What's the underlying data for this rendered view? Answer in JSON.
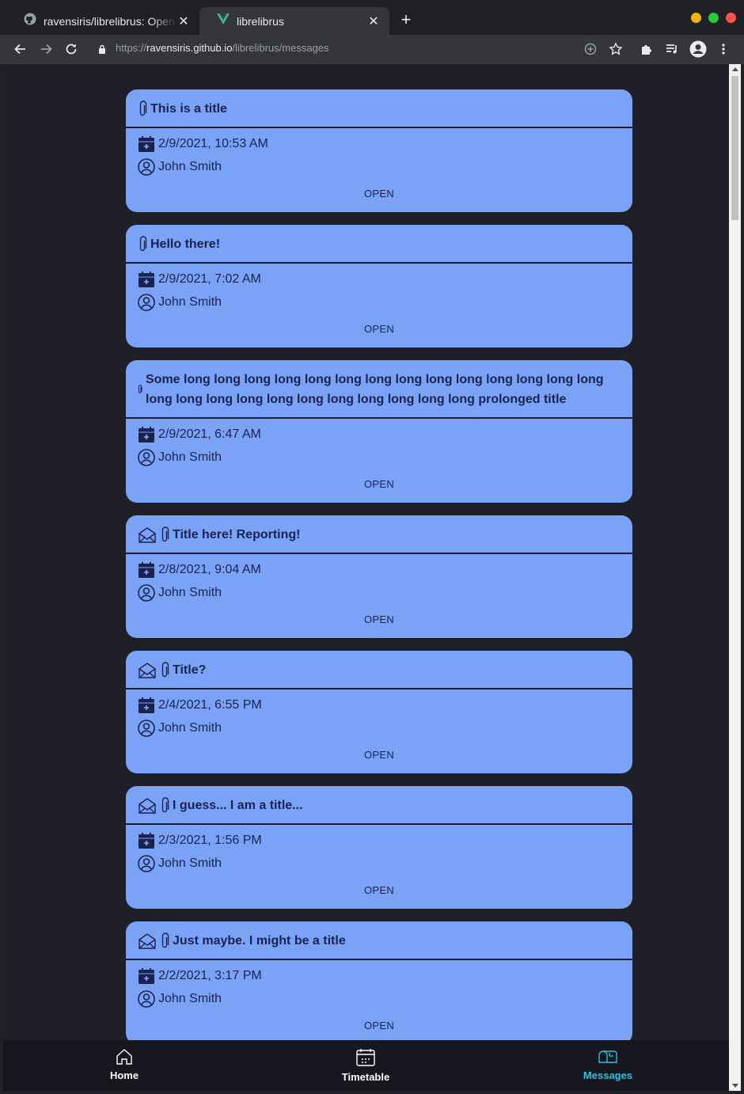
{
  "browser": {
    "tabs": [
      {
        "title": "ravensiris/librelibrus: Open source Librus client",
        "active": false
      },
      {
        "title": "librelibrus",
        "active": true
      }
    ],
    "url_scheme": "https://",
    "url_host": "ravensiris.github.io",
    "url_path": "/librelibrus/messages"
  },
  "messages": [
    {
      "title": "This is a title",
      "date": "2/9/2021, 10:53 AM",
      "author": "John Smith",
      "open_label": "OPEN",
      "unread": false
    },
    {
      "title": "Hello there!",
      "date": "2/9/2021, 7:02 AM",
      "author": "John Smith",
      "open_label": "OPEN",
      "unread": false
    },
    {
      "title": "Some long long long long long long long long long long long long long long long long long long long long long long long long long prolonged title",
      "date": "2/9/2021, 6:47 AM",
      "author": "John Smith",
      "open_label": "OPEN",
      "unread": false
    },
    {
      "title": "Title here! Reporting!",
      "date": "2/8/2021, 9:04 AM",
      "author": "John Smith",
      "open_label": "OPEN",
      "unread": true
    },
    {
      "title": "Title?",
      "date": "2/4/2021, 6:55 PM",
      "author": "John Smith",
      "open_label": "OPEN",
      "unread": true
    },
    {
      "title": "I guess... I am a title...",
      "date": "2/3/2021, 1:56 PM",
      "author": "John Smith",
      "open_label": "OPEN",
      "unread": true
    },
    {
      "title": "Just maybe. I might be a title",
      "date": "2/2/2021, 3:17 PM",
      "author": "John Smith",
      "open_label": "OPEN",
      "unread": true
    }
  ],
  "bottom_nav": [
    {
      "label": "Home",
      "icon": "home-icon",
      "active": false
    },
    {
      "label": "Timetable",
      "icon": "calendar-icon",
      "active": false
    },
    {
      "label": "Messages",
      "icon": "mailbox-icon",
      "active": true
    }
  ],
  "colors": {
    "card_bg": "#7aa2f7",
    "page_bg": "#1e1f27",
    "nav_bg": "#16161e",
    "active_nav": "#2ac3de",
    "card_text": "#1a2350"
  }
}
